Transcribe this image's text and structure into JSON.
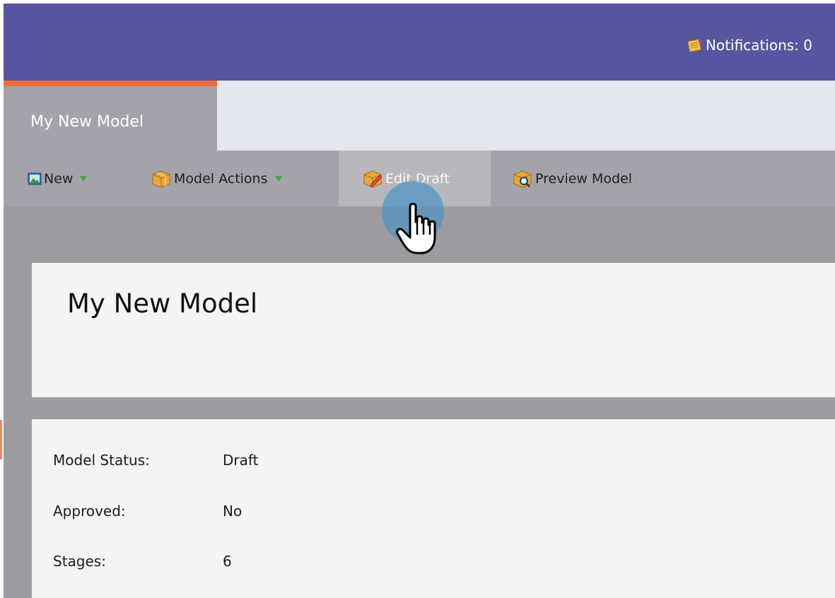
{
  "header": {
    "notifications_label": "Notifications: 0",
    "bg_color": "#5856a0",
    "notification_icon": "notepad-icon"
  },
  "tabs": [
    {
      "label": "My New Model",
      "active": true
    }
  ],
  "accent_color": "#f26b3a",
  "toolbar": {
    "new_label": "New",
    "model_actions_label": "Model Actions",
    "edit_draft_label": "Edit Draft",
    "preview_model_label": "Preview Model",
    "dropdown_caret_icon": "triangle-down-icon"
  },
  "model": {
    "title": "My New Model",
    "details": [
      {
        "label": "Model Status:",
        "value": "Draft"
      },
      {
        "label": "Approved:",
        "value": "No"
      },
      {
        "label": "Stages:",
        "value": "6"
      }
    ]
  },
  "cursor": {
    "icon": "hand-pointer-icon",
    "hovering": "edit-draft-button"
  }
}
